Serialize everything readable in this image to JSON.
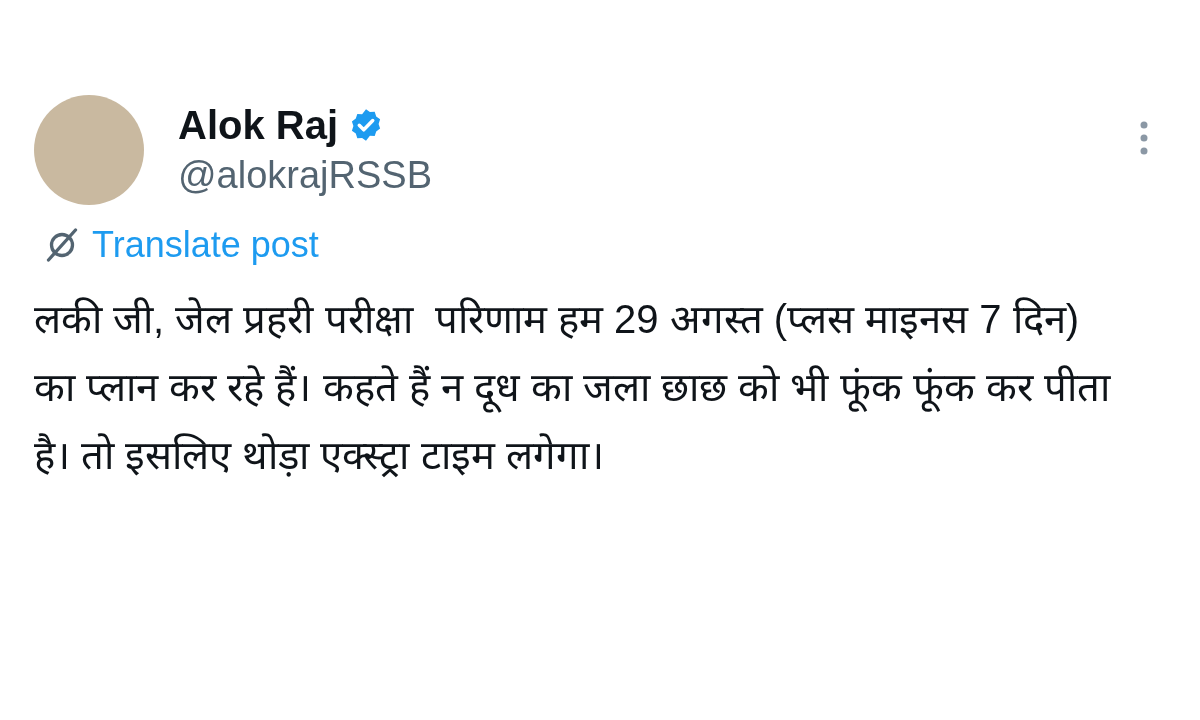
{
  "author": {
    "name": "Alok Raj",
    "verified": true,
    "handle": "@alokrajRSSB"
  },
  "translate_link": "Translate post",
  "post_text": "लकी जी, जेल प्रहरी परीक्षा  परिणाम हम 29 अगस्त (प्लस माइनस 7 दिन) का प्लान कर रहे हैं। कहते हैं न दूध का जला छाछ को भी फूंक फूंक कर पीता है। तो इसलिए थोड़ा एक्स्ट्रा टाइम लगेगा।"
}
